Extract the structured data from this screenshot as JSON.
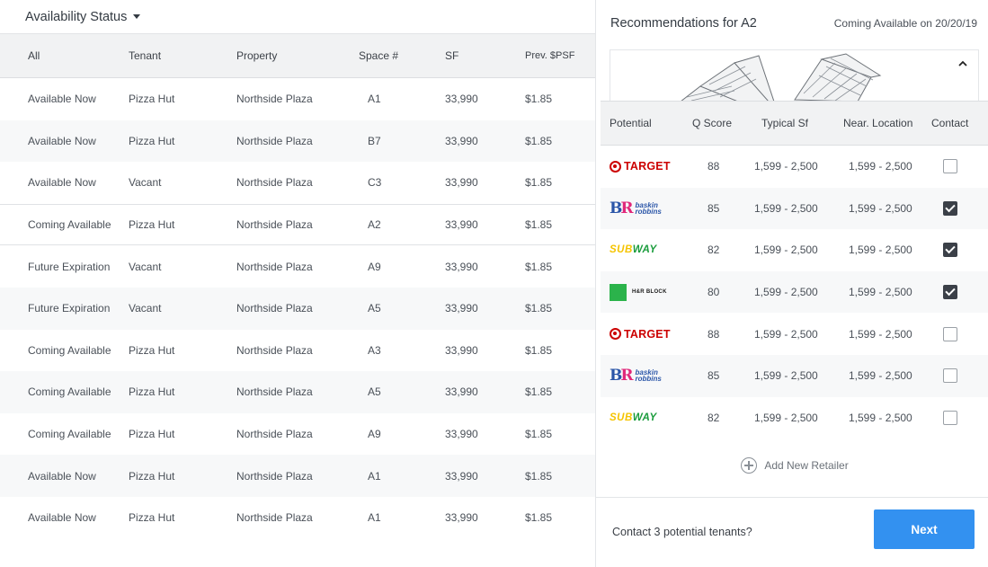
{
  "left": {
    "filter_label": "Availability Status",
    "columns": [
      "All",
      "Tenant",
      "Property",
      "Space #",
      "SF",
      "Prev. $PSF"
    ],
    "rows": [
      [
        "Available Now",
        "Pizza Hut",
        "Northside Plaza",
        "A1",
        "33,990",
        "$1.85"
      ],
      [
        "Available Now",
        "Pizza Hut",
        "Northside Plaza",
        "B7",
        "33,990",
        "$1.85"
      ],
      [
        "Available Now",
        "Vacant",
        "Northside Plaza",
        "C3",
        "33,990",
        "$1.85"
      ],
      [
        "Coming Available",
        "Pizza Hut",
        "Northside Plaza",
        "A2",
        "33,990",
        "$1.85"
      ],
      [
        "Future Expiration",
        "Vacant",
        "Northside Plaza",
        "A9",
        "33,990",
        "$1.85"
      ],
      [
        "Future Expiration",
        "Vacant",
        "Northside Plaza",
        "A5",
        "33,990",
        "$1.85"
      ],
      [
        "Coming Available",
        "Pizza Hut",
        "Northside Plaza",
        "A3",
        "33,990",
        "$1.85"
      ],
      [
        "Coming Available",
        "Pizza Hut",
        "Northside Plaza",
        "A5",
        "33,990",
        "$1.85"
      ],
      [
        "Coming Available",
        "Pizza Hut",
        "Northside Plaza",
        "A9",
        "33,990",
        "$1.85"
      ],
      [
        "Available Now",
        "Pizza Hut",
        "Northside Plaza",
        "A1",
        "33,990",
        "$1.85"
      ],
      [
        "Available Now",
        "Pizza Hut",
        "Northside Plaza",
        "A1",
        "33,990",
        "$1.85"
      ]
    ],
    "selected_row": 3
  },
  "right": {
    "title": "Recommendations for A2",
    "date_label": "Coming Available on 20/20/19",
    "columns": [
      "Potential",
      "Q Score",
      "Typical Sf",
      "Near. Location",
      "Contact"
    ],
    "rows": [
      {
        "brand": "target",
        "brand_text": "TARGET",
        "q": "88",
        "typical": "1,599 - 2,500",
        "near": "1,599 - 2,500",
        "contact": false
      },
      {
        "brand": "baskin",
        "brand_text": "baskin robbins",
        "q": "85",
        "typical": "1,599 - 2,500",
        "near": "1,599 - 2,500",
        "contact": true
      },
      {
        "brand": "subway",
        "brand_text": "SUBWAY",
        "q": "82",
        "typical": "1,599 - 2,500",
        "near": "1,599 - 2,500",
        "contact": true
      },
      {
        "brand": "hrblock",
        "brand_text": "H&R BLOCK",
        "q": "80",
        "typical": "1,599 - 2,500",
        "near": "1,599 - 2,500",
        "contact": true
      },
      {
        "brand": "target",
        "brand_text": "TARGET",
        "q": "88",
        "typical": "1,599 - 2,500",
        "near": "1,599 - 2,500",
        "contact": false
      },
      {
        "brand": "baskin",
        "brand_text": "baskin robbins",
        "q": "85",
        "typical": "1,599 - 2,500",
        "near": "1,599 - 2,500",
        "contact": false
      },
      {
        "brand": "subway",
        "brand_text": "SUBWAY",
        "q": "82",
        "typical": "1,599 - 2,500",
        "near": "1,599 - 2,500",
        "contact": false
      }
    ],
    "add_label": "Add New Retailer",
    "footer_question": "Contact 3 potential tenants?",
    "next_label": "Next",
    "accent": "#3391f0"
  }
}
